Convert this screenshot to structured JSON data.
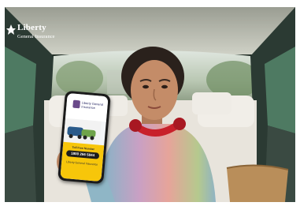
{
  "brand": {
    "name": "Liberty",
    "subtitle": "General Insurance"
  },
  "phone_screen": {
    "app_brand": "Liberty General Insurance",
    "toll_label": "Toll Free Number",
    "toll_number": "1800 266 5844",
    "footer": "Liberty General Insurance"
  },
  "colors": {
    "brand_yellow": "#f7c60a",
    "headphones_red": "#c8202a",
    "logo_text": "#ffffff"
  }
}
